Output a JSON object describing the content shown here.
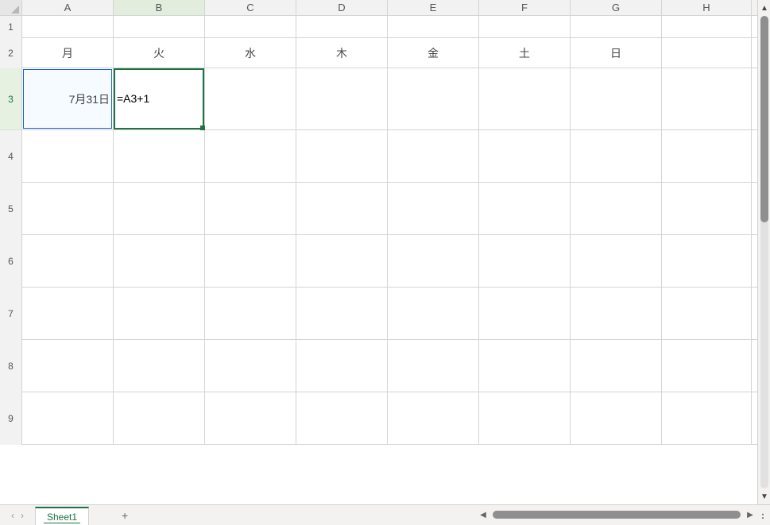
{
  "columns": [
    {
      "label": "A",
      "width": 115
    },
    {
      "label": "B",
      "width": 115
    },
    {
      "label": "C",
      "width": 115
    },
    {
      "label": "D",
      "width": 115
    },
    {
      "label": "E",
      "width": 115
    },
    {
      "label": "F",
      "width": 115
    },
    {
      "label": "G",
      "width": 115
    },
    {
      "label": "H",
      "width": 113
    }
  ],
  "rows": [
    {
      "n": "1",
      "h": 28
    },
    {
      "n": "2",
      "h": 38
    },
    {
      "n": "3",
      "h": 78
    },
    {
      "n": "4",
      "h": 66
    },
    {
      "n": "5",
      "h": 66
    },
    {
      "n": "6",
      "h": 66
    },
    {
      "n": "7",
      "h": 66
    },
    {
      "n": "8",
      "h": 66
    },
    {
      "n": "9",
      "h": 66
    }
  ],
  "headerRow": {
    "index": 1,
    "values": [
      "月",
      "火",
      "水",
      "木",
      "金",
      "土",
      "日",
      ""
    ]
  },
  "cellA3": "7月31日",
  "activeCell": {
    "col": 1,
    "row": 2,
    "formula": "=A3+1",
    "address": "B3"
  },
  "reference": {
    "col": 0,
    "row": 2,
    "address": "A3"
  },
  "sheetTab": "Sheet1",
  "addSheetIcon": "+",
  "tabMenuIcon": ":",
  "navPrev": "‹",
  "navNext": "›",
  "arrows": {
    "left": "◀",
    "right": "▶",
    "up": "▲",
    "down": "▼"
  }
}
